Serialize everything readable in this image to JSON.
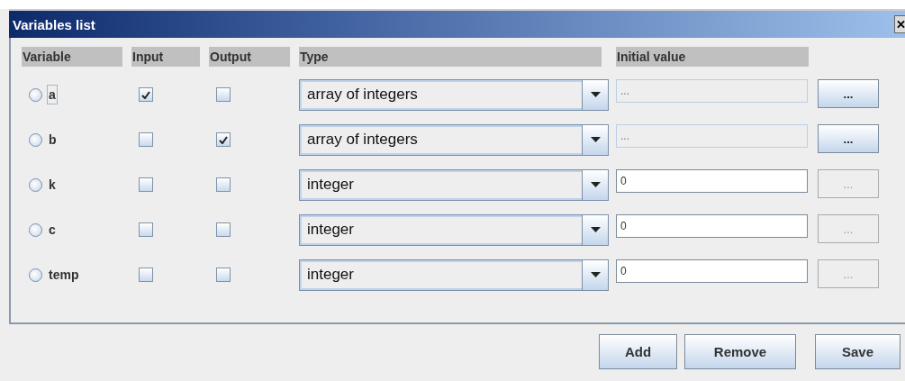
{
  "window": {
    "title": "Variables list"
  },
  "columns": [
    "Variable",
    "Input",
    "Output",
    "Type",
    "Initial value"
  ],
  "rows": [
    {
      "name": "a",
      "selected": false,
      "focused": true,
      "input": true,
      "output": false,
      "type": "array of integers",
      "initial_value": "...",
      "value_disabled": true,
      "edit_button": "...",
      "button_disabled": false
    },
    {
      "name": "b",
      "selected": false,
      "focused": false,
      "input": false,
      "output": true,
      "type": "array of integers",
      "initial_value": "...",
      "value_disabled": true,
      "edit_button": "...",
      "button_disabled": false
    },
    {
      "name": "k",
      "selected": false,
      "focused": false,
      "input": false,
      "output": false,
      "type": "integer",
      "initial_value": "0",
      "value_disabled": false,
      "edit_button": "...",
      "button_disabled": true
    },
    {
      "name": "c",
      "selected": false,
      "focused": false,
      "input": false,
      "output": false,
      "type": "integer",
      "initial_value": "0",
      "value_disabled": false,
      "edit_button": "...",
      "button_disabled": true
    },
    {
      "name": "temp",
      "selected": false,
      "focused": false,
      "input": false,
      "output": false,
      "type": "integer",
      "initial_value": "0",
      "value_disabled": false,
      "edit_button": "...",
      "button_disabled": true
    }
  ],
  "buttons": [
    "Add",
    "Remove",
    "Save"
  ]
}
